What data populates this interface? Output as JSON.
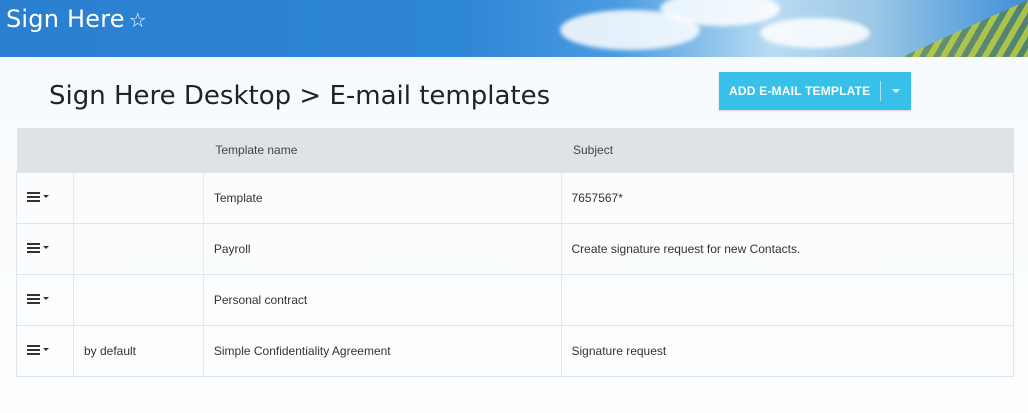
{
  "app": {
    "title": "Sign Here",
    "star_icon": "star-outline-icon"
  },
  "page": {
    "title": "Sign Here Desktop > E-mail templates"
  },
  "actions": {
    "add_label": "ADD E-MAIL TEMPLATE",
    "caret_icon": "caret-down-icon"
  },
  "colors": {
    "accent": "#36c0ea",
    "header_bg": "#dfe3e6"
  },
  "table": {
    "columns": [
      "",
      "",
      "Template name",
      "Subject"
    ],
    "rows": [
      {
        "flag": "",
        "name": "Template",
        "subject": "7657567*"
      },
      {
        "flag": "",
        "name": "Payroll",
        "subject": "Create signature request for new Contacts."
      },
      {
        "flag": "",
        "name": "Personal contract",
        "subject": ""
      },
      {
        "flag": "by default",
        "name": "Simple Confidentiality Agreement",
        "subject": "Signature request"
      }
    ]
  }
}
